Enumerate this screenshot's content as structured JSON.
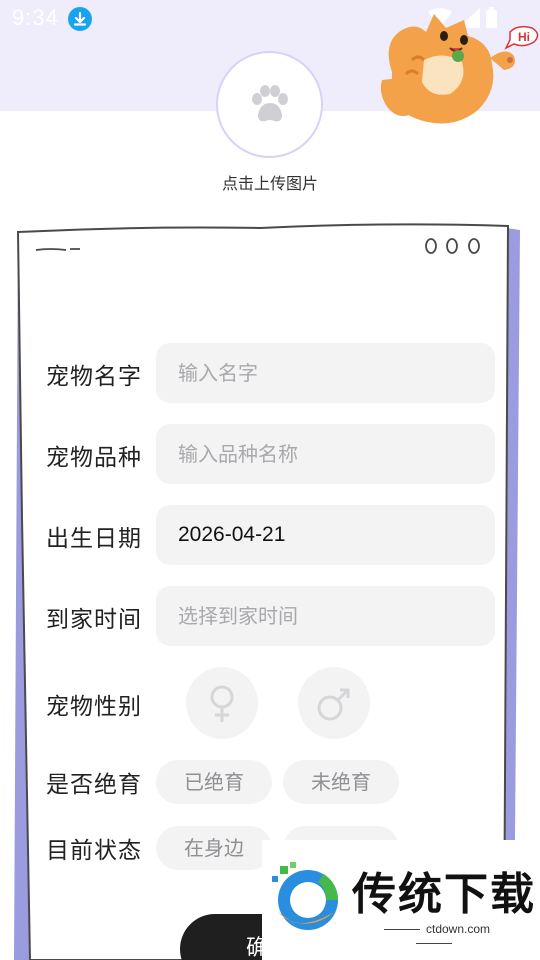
{
  "status_bar": {
    "time": "9:34"
  },
  "upload": {
    "label": "点击上传图片"
  },
  "form": {
    "name": {
      "label": "宠物名字",
      "placeholder": "输入名字"
    },
    "breed": {
      "label": "宠物品种",
      "placeholder": "输入品种名称"
    },
    "birthday": {
      "label": "出生日期",
      "value": "2026-04-21"
    },
    "arrival": {
      "label": "到家时间",
      "placeholder": "选择到家时间"
    },
    "gender": {
      "label": "宠物性别"
    },
    "neutered": {
      "label": "是否绝育",
      "options": [
        "已绝育",
        "未绝育"
      ]
    },
    "status": {
      "label": "目前状态",
      "options": [
        "在身边"
      ]
    }
  },
  "confirm": {
    "label": "确"
  },
  "watermark": {
    "brand": "传统下载",
    "url": "ctdown.com"
  },
  "colors": {
    "accent_lavender": "#efecfc",
    "paper_edge": "#9b9be0",
    "button_dark": "#1f1f1f",
    "field_bg": "#f3f3f4"
  },
  "icons": [
    "download-icon",
    "wifi-icon",
    "signal-icon",
    "battery-icon",
    "paw-icon",
    "female-icon",
    "male-icon"
  ]
}
